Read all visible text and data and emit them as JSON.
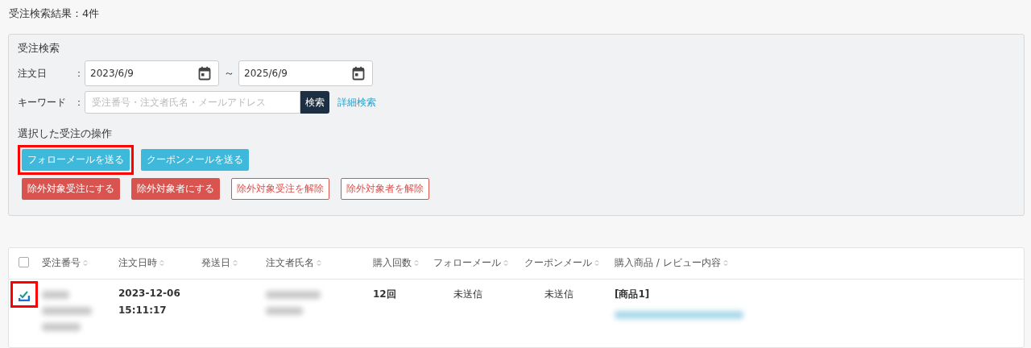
{
  "result_title": "受注検索結果：4件",
  "search": {
    "title": "受注検索",
    "order_date": {
      "label": "注文日",
      "colon": "：",
      "from": "2023/6/9",
      "separator": "～",
      "to": "2025/6/9"
    },
    "keyword": {
      "label": "キーワード",
      "colon": "：",
      "placeholder": "受注番号・注文者氏名・メールアドレス",
      "button": "検索",
      "advanced_link": "詳細検索"
    }
  },
  "operations": {
    "title": "選択した受注の操作",
    "rows": [
      [
        {
          "label": "フォローメールを送る",
          "kind": "info",
          "highlighted": true
        },
        {
          "label": "クーポンメールを送る",
          "kind": "info",
          "highlighted": false
        }
      ],
      [
        {
          "label": "除外対象受注にする",
          "kind": "danger",
          "highlighted": false
        },
        {
          "label": "除外対象者にする",
          "kind": "danger",
          "highlighted": false
        },
        {
          "label": "除外対象受注を解除",
          "kind": "danger-outline",
          "highlighted": false
        },
        {
          "label": "除外対象者を解除",
          "kind": "danger-outline",
          "highlighted": false
        }
      ]
    ]
  },
  "table": {
    "select_all": {
      "checked": false
    },
    "columns": [
      "受注番号",
      "注文日時",
      "発送日",
      "注文者氏名",
      "購入回数",
      "フォローメール",
      "クーポンメール",
      "購入商品 / レビュー内容"
    ],
    "rows": [
      {
        "checked": true,
        "highlighted": true,
        "order_number": {
          "kind": "redacted"
        },
        "order_datetime": [
          "2023-12-06",
          "15:11:17"
        ],
        "customer_name": {
          "kind": "redacted"
        },
        "purchase_count": "12回",
        "follow_mail": "未送信",
        "coupon_mail": "未送信",
        "product": "[商品1]",
        "review": {
          "kind": "redacted"
        }
      }
    ]
  }
}
